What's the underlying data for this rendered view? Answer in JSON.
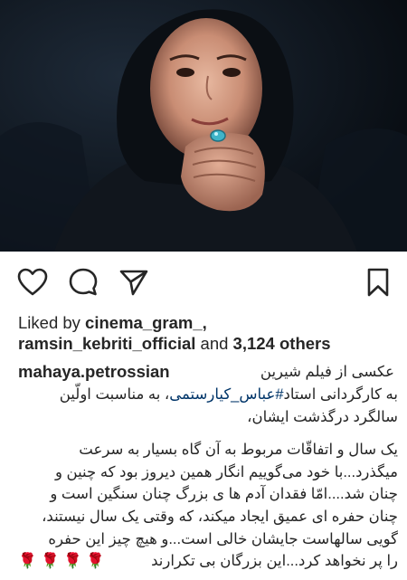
{
  "post": {
    "likes": {
      "prefix": "Liked by",
      "user1": "cinema_gram_,",
      "user2": "ramsin_kebriti_official",
      "and_text": "and",
      "others": "3,124 others"
    },
    "caption": {
      "username": "mahaya.petrossian",
      "first_line": "عکسی از فیلم شیرین",
      "line2_before": "به کارگردانی استاد",
      "hashtag": "#عباس_کیارستمی",
      "line2_after": "، به مناسبت اولّین",
      "line3": "سالگرد درگذشت ایشان،",
      "para2": [
        "یک سال و اتفاقّات مربوط به آن گاه بسیار به سرعت",
        "میگذرد...با خود می‌گوییم انگار همین دیروز بود که چنین و",
        "چنان شد....امّا فقدان آدم ها ی بزرگ چنان سنگین است و",
        "چنان حفره ای عمیق ایجاد میکند، که وقتی یک سال نیستند،",
        "گویی سالهاست جایشان خالی است...و هیچ چیز این حفره",
        "را پر نخواهد کرد...این بزرگان بی تکرارند"
      ],
      "roses": "🌹 🌹 🌹 🌹"
    }
  },
  "icons": {
    "like": "heart-outline",
    "comment": "speech-bubble-outline",
    "share": "paper-plane-outline",
    "save": "bookmark-outline"
  },
  "colors": {
    "text": "#262626",
    "hashtag": "#003569",
    "rose": "#d01c1f"
  }
}
